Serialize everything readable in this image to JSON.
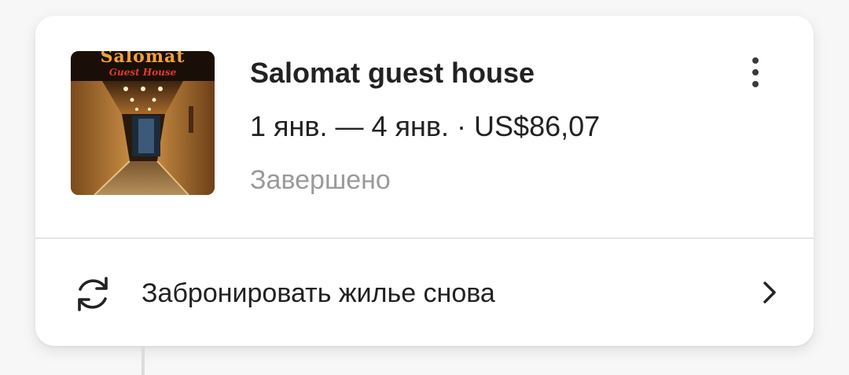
{
  "booking": {
    "title": "Salomat guest house",
    "dates_price": "1 янв. — 4 янв. · US$86,07",
    "status": "Завершено",
    "image": {
      "sign_top": "Salomat",
      "sign_sub": "Guest House"
    }
  },
  "actions": {
    "rebook_label": "Забронировать жилье снова",
    "rebook_icon": "refresh-icon",
    "chevron_icon": "chevron-right-icon",
    "more_icon": "more-vertical-icon"
  },
  "colors": {
    "text_primary": "#222222",
    "text_secondary": "#9a9a9a",
    "card_bg": "#ffffff",
    "page_bg": "#f7f7f7"
  }
}
